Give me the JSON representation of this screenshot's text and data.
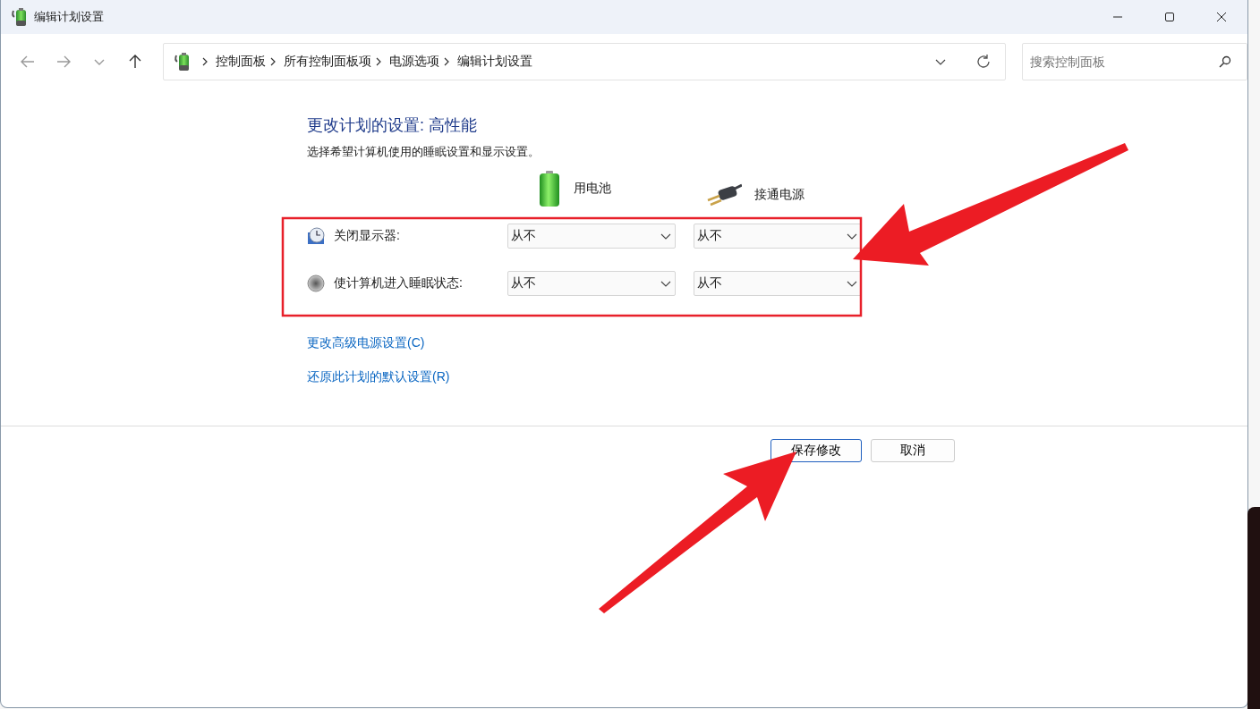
{
  "window": {
    "title": "编辑计划设置"
  },
  "address_bar": {
    "breadcrumbs": [
      "控制面板",
      "所有控制面板项",
      "电源选项",
      "编辑计划设置"
    ]
  },
  "search": {
    "placeholder": "搜索控制面板"
  },
  "heading": "更改计划的设置: 高性能",
  "description": "选择希望计算机使用的睡眠设置和显示设置。",
  "columns": [
    {
      "kind": "battery",
      "label": "用电池"
    },
    {
      "kind": "plugged",
      "label": "接通电源"
    }
  ],
  "settings": [
    {
      "kind": "display",
      "label": "关闭显示器:",
      "values": [
        "从不",
        "从不"
      ]
    },
    {
      "kind": "sleep",
      "label": "使计算机进入睡眠状态:",
      "values": [
        "从不",
        "从不"
      ]
    }
  ],
  "links": [
    "更改高级电源设置(C)",
    "还原此计划的默认设置(R)"
  ],
  "buttons": [
    {
      "label": "保存修改",
      "default": true
    },
    {
      "label": "取消",
      "default": false
    }
  ]
}
